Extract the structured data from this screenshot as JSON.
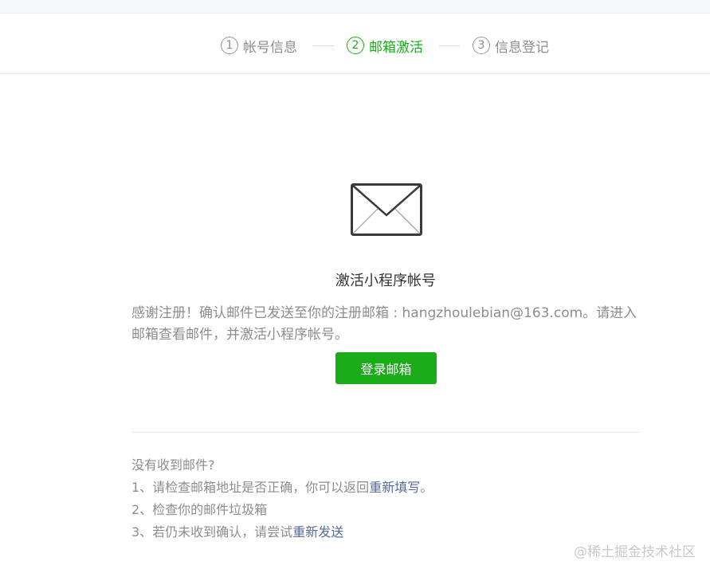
{
  "steps": [
    {
      "num": "1",
      "label": "帐号信息",
      "active": false
    },
    {
      "num": "2",
      "label": "邮箱激活",
      "active": true
    },
    {
      "num": "3",
      "label": "信息登记",
      "active": false
    }
  ],
  "icons": {
    "mail": "envelope-icon"
  },
  "colors": {
    "accent": "#1aad19",
    "link": "#576b95",
    "muted": "#8d8d8d"
  },
  "main": {
    "title": "激活小程序帐号",
    "description": "感谢注册！确认邮件已发送至你的注册邮箱 : hangzhoulebian@163.com。请进入邮箱查看邮件，并激活小程序帐号。",
    "login_button": "登录邮箱"
  },
  "tips": {
    "heading": "没有收到邮件?",
    "item1_prefix": "1、请检查邮箱地址是否正确，你可以返回",
    "item1_link": "重新填写",
    "item1_suffix": "。",
    "item2": "2、检查你的邮件垃圾箱",
    "item3_prefix": "3、若仍未收到确认，请尝试",
    "item3_link": "重新发送"
  },
  "watermark": "@稀土掘金技术社区"
}
